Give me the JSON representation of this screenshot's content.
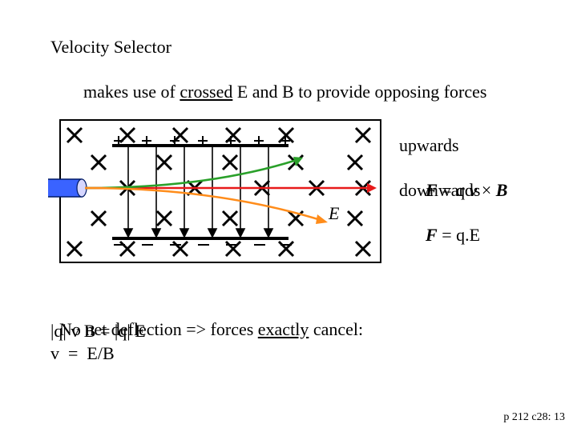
{
  "title": "Velocity Selector",
  "subtitle_pre": "makes use of ",
  "subtitle_u": "crossed",
  "subtitle_post": " E and B to provide opposing forces",
  "e_label": "E",
  "legend": {
    "up_label": "upwards",
    "up_eq_F": "F",
    "up_eq_mid": " = q ",
    "up_eq_v": "v",
    "up_eq_cross": " × ",
    "up_eq_B": "B",
    "down_label": "downwards",
    "down_eq_F": "F",
    "down_eq_rest": " = q.E"
  },
  "deflection_pre": "No net deflection => forces ",
  "deflection_u": "exactly",
  "deflection_post": " cancel:",
  "eq1": "|q| v B = |q| E",
  "eq2": "v  =  E/B",
  "footer": "p 212 c28: 13"
}
